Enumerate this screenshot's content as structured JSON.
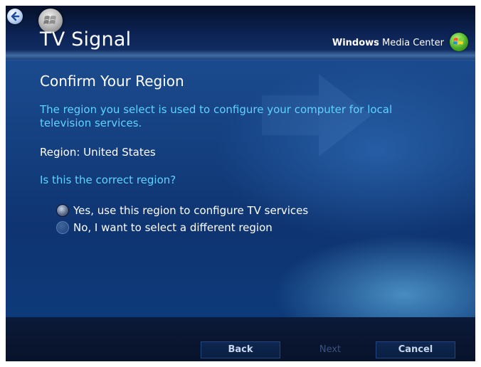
{
  "header": {
    "title": "TV Signal",
    "brand_bold": "Windows",
    "brand_rest": " Media Center"
  },
  "main": {
    "heading": "Confirm Your Region",
    "description": "The region you select is used to configure your computer for local television services.",
    "region_text": "Region: United States",
    "question": "Is this the correct region?",
    "options": [
      {
        "label": "Yes, use this region to configure TV services",
        "selected": true
      },
      {
        "label": "No, I want to select a different region",
        "selected": false
      }
    ]
  },
  "footer": {
    "back_label": "Back",
    "next_label": "Next",
    "cancel_label": "Cancel"
  },
  "colors": {
    "accent_text": "#5fd3ff",
    "background": "#143f7f"
  },
  "icons": [
    "back-arrow-icon",
    "windows-start-orb-icon",
    "media-center-logo-icon"
  ]
}
